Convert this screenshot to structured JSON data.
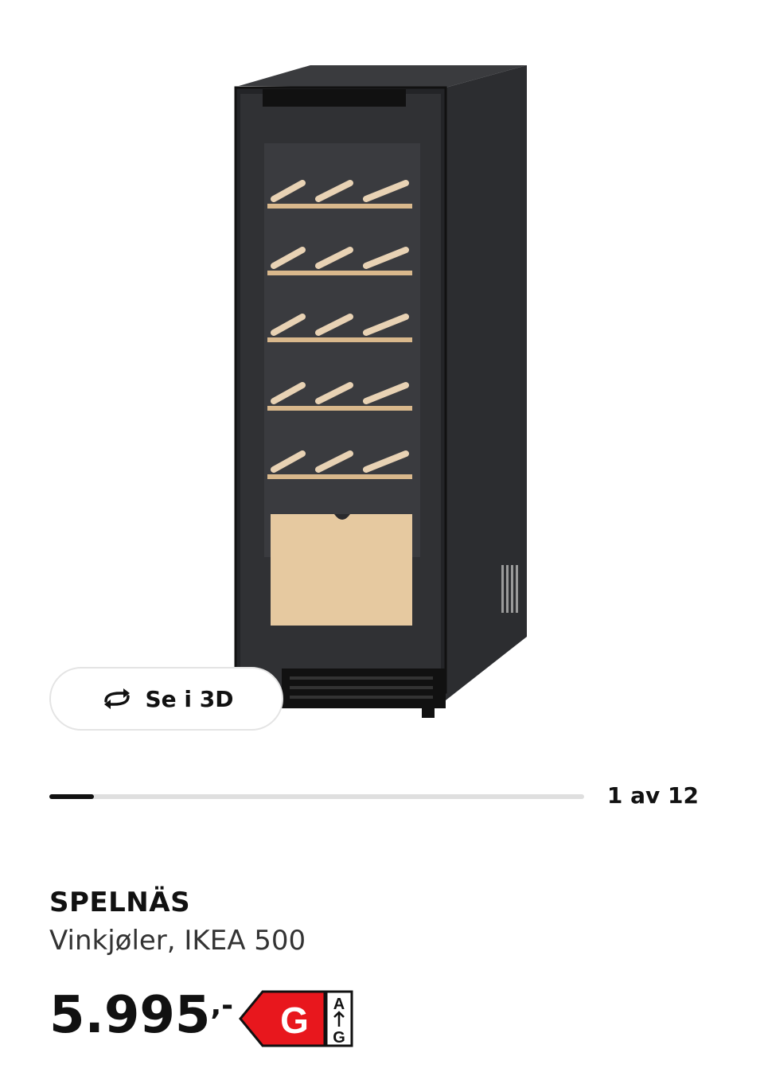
{
  "gallery": {
    "view_3d_label": "Se i 3D",
    "counter": "1 av 12",
    "progress_fraction": 0.083
  },
  "product": {
    "name": "SPELNÄS",
    "description": "Vinkjøler, IKEA 500",
    "price_main": "5.995",
    "price_suffix": ",-",
    "energy_class": "G",
    "energy_scale_top": "A",
    "energy_scale_bottom": "G",
    "energy_color": "#e8171d"
  }
}
